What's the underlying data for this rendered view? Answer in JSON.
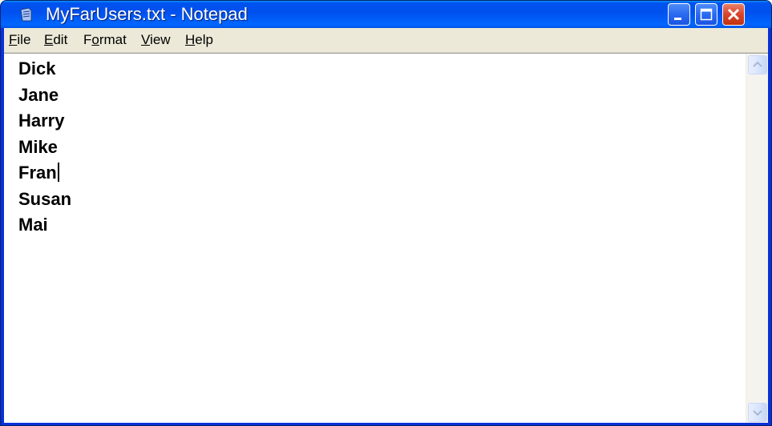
{
  "window": {
    "title": "MyFarUsers.txt - Notepad",
    "app_icon": "notepad-icon"
  },
  "menu": [
    {
      "label": "File",
      "mnemonic": "F",
      "rest": "ile"
    },
    {
      "label": "Edit",
      "mnemonic": "E",
      "rest": "dit"
    },
    {
      "label": "Format",
      "pre": "F",
      "mnemonic": "o",
      "rest": "rmat"
    },
    {
      "label": "View",
      "mnemonic": "V",
      "rest": "iew"
    },
    {
      "label": "Help",
      "mnemonic": "H",
      "rest": "elp"
    }
  ],
  "document": {
    "lines": [
      "Dick",
      "Jane",
      "Harry",
      "Mike",
      "Fran",
      "Susan",
      "Mai"
    ],
    "caret_line": 4
  },
  "colors": {
    "titlebar": "#0054e3",
    "menubar": "#ece9d8",
    "close_button": "#d9442a"
  }
}
